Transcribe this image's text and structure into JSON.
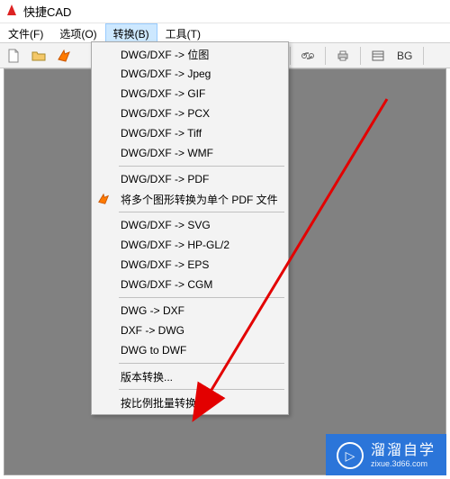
{
  "app": {
    "title": "快捷CAD"
  },
  "menubar": {
    "items": [
      {
        "label": "文件(F)"
      },
      {
        "label": "选项(O)"
      },
      {
        "label": "转换(B)",
        "active": true
      },
      {
        "label": "工具(T)"
      }
    ]
  },
  "toolbar": {
    "bg_label": "BG"
  },
  "dropdown": {
    "groups": [
      [
        {
          "label": "DWG/DXF -> 位图"
        },
        {
          "label": "DWG/DXF -> Jpeg"
        },
        {
          "label": "DWG/DXF -> GIF"
        },
        {
          "label": "DWG/DXF -> PCX"
        },
        {
          "label": "DWG/DXF -> Tiff"
        },
        {
          "label": "DWG/DXF -> WMF"
        }
      ],
      [
        {
          "label": "DWG/DXF -> PDF"
        },
        {
          "label": "将多个图形转换为单个 PDF 文件",
          "icon": "arrow"
        }
      ],
      [
        {
          "label": "DWG/DXF -> SVG"
        },
        {
          "label": "DWG/DXF -> HP-GL/2"
        },
        {
          "label": "DWG/DXF -> EPS"
        },
        {
          "label": "DWG/DXF -> CGM"
        }
      ],
      [
        {
          "label": "DWG -> DXF"
        },
        {
          "label": "DXF -> DWG"
        },
        {
          "label": "DWG to DWF"
        }
      ],
      [
        {
          "label": "版本转换..."
        }
      ],
      [
        {
          "label": "按比例批量转换..."
        }
      ]
    ]
  },
  "watermark": {
    "main": "溜溜自学",
    "sub": "zixue.3d66.com",
    "play_glyph": "▷"
  }
}
